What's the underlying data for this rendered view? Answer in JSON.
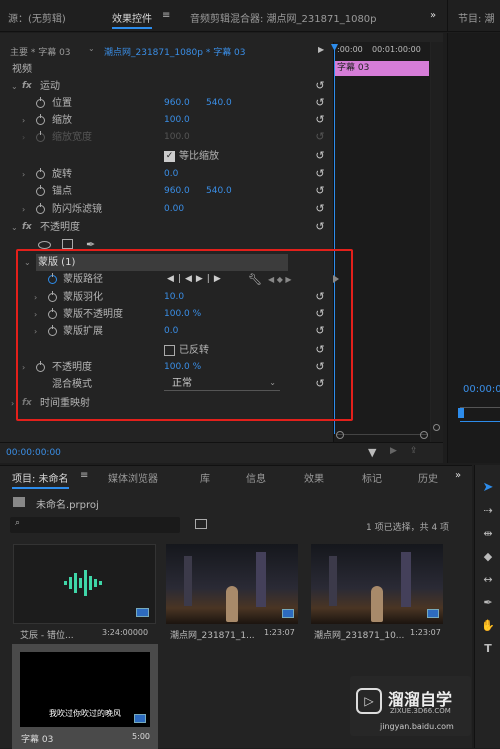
{
  "tabs": {
    "source": "源：(无剪辑)",
    "effect_controls": "效果控件",
    "effect_menu": "≡",
    "audio_mixer": "音频剪辑混合器: 潮点网_231871_1080p",
    "more": "»",
    "program": "节目: 潮"
  },
  "ecp": {
    "master": "主要 * 字幕 03",
    "sequence": "潮点网_231871_1080p * 字幕 03",
    "time_start": ":00:00",
    "time_end": "00:01:00:00",
    "clip_name": "字幕 03",
    "video": "视频",
    "timecode": "00:00:00:00",
    "program_timecode": "00:00:0"
  },
  "motion": {
    "label": "运动",
    "position": "位置",
    "position_x": "960.0",
    "position_y": "540.0",
    "scale": "缩放",
    "scale_val": "100.0",
    "scale_width": "缩放宽度",
    "scale_width_val": "100.0",
    "uniform": "等比缩放",
    "rotation": "旋转",
    "rotation_val": "0.0",
    "anchor": "锚点",
    "anchor_x": "960.0",
    "anchor_y": "540.0",
    "flicker": "防闪烁滤镜",
    "flicker_val": "0.00"
  },
  "opacity": {
    "label": "不透明度",
    "mask": "蒙版 (1)",
    "mask_path": "蒙版路径",
    "mask_feather": "蒙版羽化",
    "mask_feather_val": "10.0",
    "mask_opacity": "蒙版不透明度",
    "mask_opacity_val": "100.0 %",
    "mask_expansion": "蒙版扩展",
    "mask_expansion_val": "0.0",
    "inverted": "已反转",
    "opacity_label": "不透明度",
    "opacity_val": "100.0 %",
    "blend_mode": "混合模式",
    "blend_val": "正常",
    "time_remap": "时间重映射"
  },
  "project": {
    "tab_project": "项目: 未命名",
    "tab_menu": "≡",
    "tab_media": "媒体浏览器",
    "tab_library": "库",
    "tab_info": "信息",
    "tab_effects": "效果",
    "tab_markers": "标记",
    "tab_history": "历史",
    "more": "»",
    "file": "未命名.prproj",
    "selected": "1 项已选择，共 4 项",
    "items": [
      {
        "name": "艾辰 - 错位...",
        "dur": "3:24:00000"
      },
      {
        "name": "潮点网_231871_1...",
        "dur": "1:23:07"
      },
      {
        "name": "潮点网_231871_10...",
        "dur": "1:23:07"
      },
      {
        "name": "字幕 03",
        "dur": "5:00",
        "caption": "我吹过你吹过的晚风"
      }
    ]
  },
  "watermark": {
    "brand": "溜溜自学",
    "url": "ZIXUE.3D66.COM",
    "site": "jingyan.baidu.com"
  }
}
